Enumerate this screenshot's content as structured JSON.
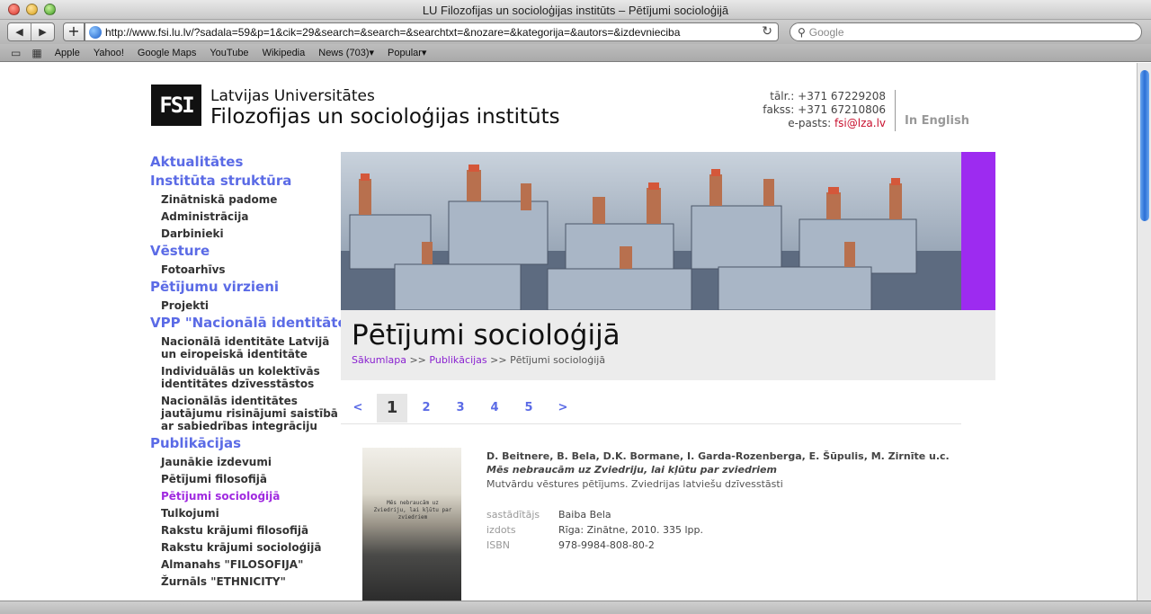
{
  "window": {
    "title": "LU Filozofijas un socioloģijas institūts – Pētījumi socioloģijā"
  },
  "toolbar": {
    "url": "http://www.fsi.lu.lv/?sadala=59&p=1&cik=29&search=&search=&searchtxt=&nozare=&kategorija=&autors=&izdevnieciba",
    "search_placeholder": "Google",
    "add_label": "+",
    "back_glyph": "◀",
    "forward_glyph": "▶",
    "reload_glyph": "↻"
  },
  "bookmarks": [
    {
      "label": "Apple"
    },
    {
      "label": "Yahoo!"
    },
    {
      "label": "Google Maps"
    },
    {
      "label": "YouTube"
    },
    {
      "label": "Wikipedia"
    },
    {
      "label": "News (703)▾"
    },
    {
      "label": "Popular▾"
    }
  ],
  "header": {
    "logo_text": "FSI",
    "university": "Latvijas Universitātes",
    "institute": "Filozofijas un socioloģijas institūts",
    "phone": "tālr.: +371 67229208",
    "fax": "fakss: +371 67210806",
    "email_label": "e-pasts:",
    "email": "fsi@lza.lv",
    "english_link": "In English"
  },
  "sidebar": {
    "aktualitates": "Aktualitātes",
    "struktura": "Institūta struktūra",
    "padome": "Zinātniskā padome",
    "administracija": "Administrācija",
    "darbinieki": "Darbinieki",
    "vesture": "Vēsture",
    "fotoarhivs": "Fotoarhīvs",
    "virzieni": "Pētījumu virzieni",
    "projekti": "Projekti",
    "vpp": "VPP \"Nacionālā identitāte\"",
    "nac1": "Nacionālā identitāte Latvijā un eiropeiskā identitāte",
    "nac2": "Individuālās un kolektīvās identitātes dzīvesstāstos",
    "nac3": "Nacionālās identitātes jautājumu risinājumi saistībā ar sabiedrības integrāciju",
    "publikacijas": "Publikācijas",
    "jaunakie": "Jaunākie izdevumi",
    "filosofija": "Pētījumi filosofijā",
    "sociologija": "Pētījumi socioloģijā",
    "tulkojumi": "Tulkojumi",
    "krajumi_fil": "Rakstu krājumi filosofijā",
    "krajumi_soc": "Rakstu krājumi socioloģijā",
    "almanahs": "Almanahs \"FILOSOFIJA\"",
    "zurnals": "Žurnāls \"ETHNICITY\""
  },
  "main": {
    "title": "Pētījumi socioloģijā",
    "crumb_home": "Sākumlapa",
    "crumb_sep": ">>",
    "crumb_pub": "Publikācijas",
    "crumb_current": "Pētījumi socioloģijā",
    "pager": {
      "prev": "<",
      "p1": "1",
      "p2": "2",
      "p3": "3",
      "p4": "4",
      "p5": "5",
      "next": ">"
    }
  },
  "publication": {
    "cover_text": "Mēs nebraucām uz Zviedriju, lai kļūtu par zviedriem",
    "authors": "D. Beitnere, B. Bela, D.K. Bormane, I. Garda-Rozenberga, E. Šūpulis, M. Zirnīte u.c.",
    "title": "Mēs nebraucām uz Zviedriju, lai kļūtu par zviedriem",
    "subtitle": "Mutvārdu vēstures pētījums. Zviedrijas latviešu dzīvesstāsti",
    "compiler_label": "sastādītājs",
    "compiler": "Baiba Bela",
    "published_label": "izdots",
    "published": "Rīga: Zinātne, 2010. 335 lpp.",
    "isbn_label": "ISBN",
    "isbn": "978-9984-808-80-2"
  },
  "colors": {
    "accent": "#5b6be6",
    "active": "#a02ae0",
    "banner": "#9d2bf0"
  }
}
